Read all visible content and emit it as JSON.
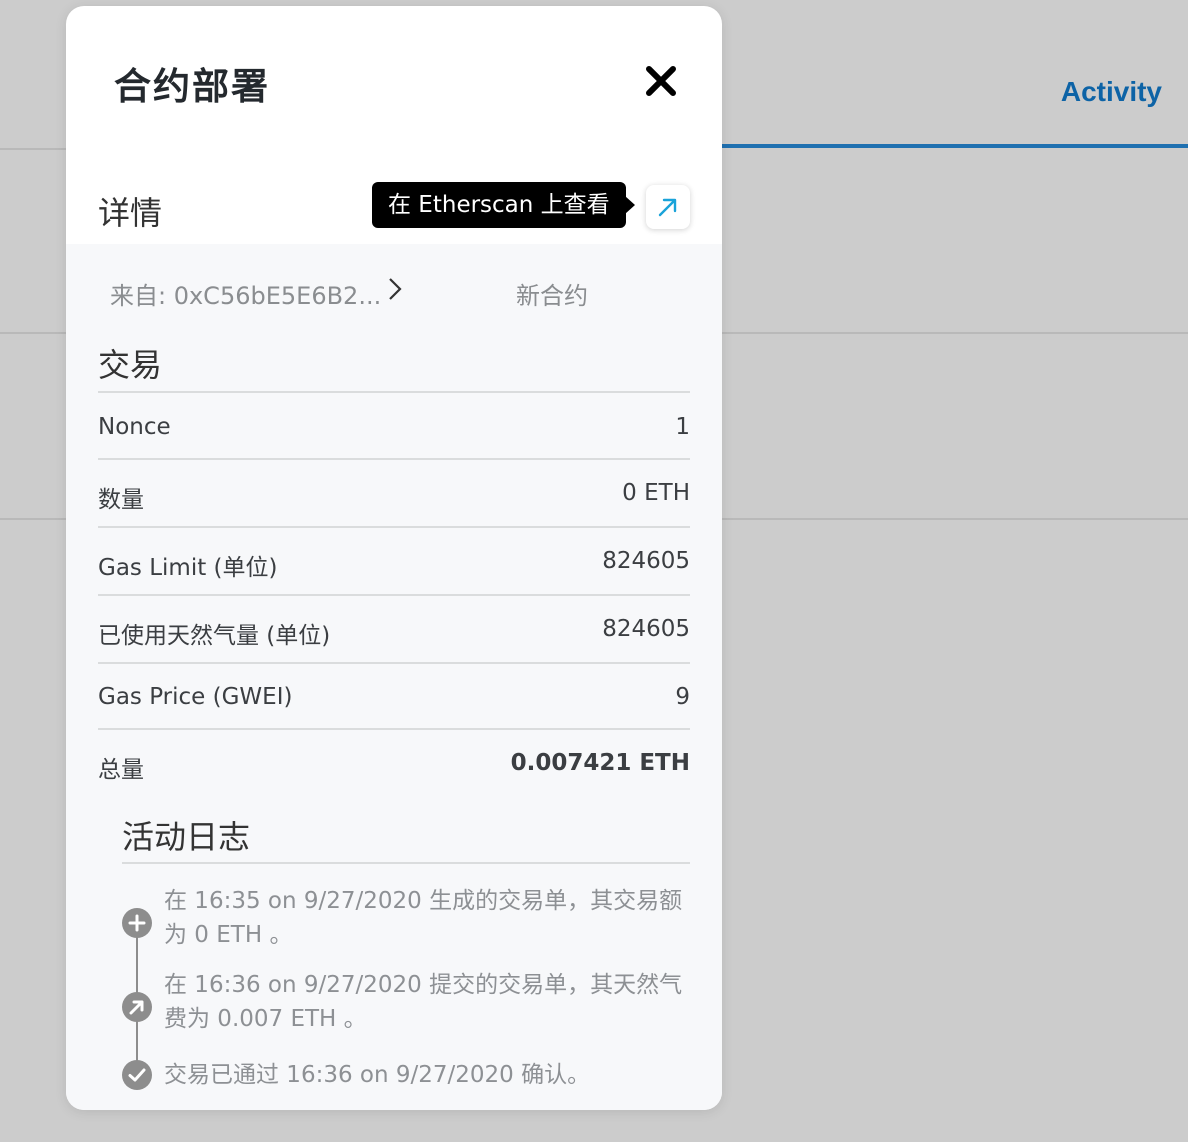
{
  "background": {
    "tab_label": "Activity"
  },
  "modal": {
    "title": "合约部署",
    "close_icon": "close-icon",
    "details_label": "详情",
    "etherscan_tooltip": "在 Etherscan 上查看",
    "etherscan_icon": "external-link-arrow-icon",
    "from_label": "来自: 0xC56bE5E6B2...",
    "to_label": "新合约",
    "transaction_title": "交易",
    "rows": [
      {
        "label": "Nonce",
        "value": "1"
      },
      {
        "label": "数量",
        "value": "0 ETH"
      },
      {
        "label": "Gas Limit (单位)",
        "value": "824605"
      },
      {
        "label": "已使用天然气量 (单位)",
        "value": "824605"
      },
      {
        "label": "Gas Price (GWEI)",
        "value": "9"
      },
      {
        "label": "总量",
        "value": "0.007421 ETH"
      }
    ],
    "activity_log_title": "活动日志",
    "activity_log": [
      {
        "icon": "plus-circle-icon",
        "line1": "在 16:35 on 9/27/2020 生成的交易单，其交易额",
        "line2": "为 0 ETH 。"
      },
      {
        "icon": "arrow-circle-icon",
        "line1": "在 16:36 on 9/27/2020 提交的交易单，其天然气",
        "line2": "费为 0.007 ETH 。"
      },
      {
        "icon": "check-circle-icon",
        "line1": "交易已通过 16:36 on 9/27/2020 确认。",
        "line2": ""
      }
    ]
  },
  "colors": {
    "accent": "#0d63a6",
    "tooltip_bg": "#000000",
    "link_arrow": "#1aa3d9",
    "muted_text": "#8d9094"
  }
}
